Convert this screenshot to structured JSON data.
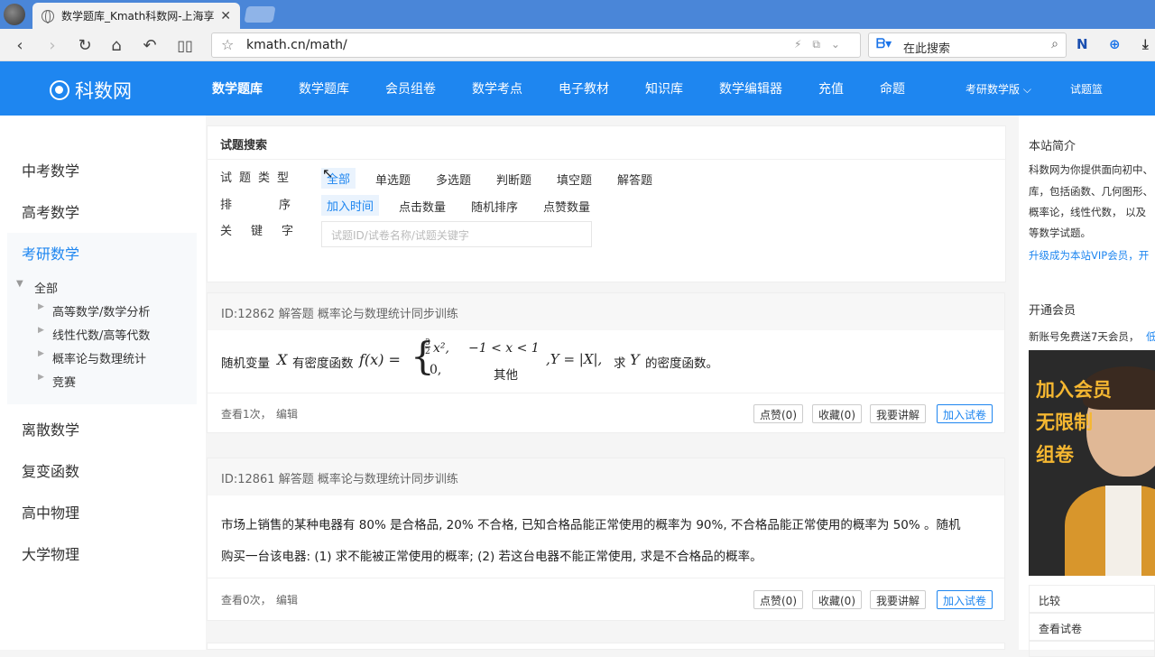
{
  "browser": {
    "tab_title": "数学题库_Kmath科数网-上海享",
    "url": "kmath.cn/math/",
    "search_placeholder": "在此搜索"
  },
  "site": {
    "logo_text": "科数网",
    "nav": [
      "数学题库",
      "数学题库",
      "会员组卷",
      "数学考点",
      "电子教材",
      "知识库",
      "数学编辑器",
      "充值",
      "命题",
      "考研数学版",
      "试题篮"
    ]
  },
  "sidebar": {
    "items": [
      "中考数学",
      "高考数学",
      "考研数学",
      "离散数学",
      "复变函数",
      "高中物理",
      "大学物理"
    ],
    "tree_root": "全部",
    "tree_children": [
      "高等数学/数学分析",
      "线性代数/高等代数",
      "概率论与数理统计",
      "竞赛"
    ]
  },
  "filter": {
    "title": "试题搜索",
    "type_label": "试题类型",
    "type_options": [
      "全部",
      "单选题",
      "多选题",
      "判断题",
      "填空题",
      "解答题"
    ],
    "sort_label": "排序",
    "sort_options": [
      "加入时间",
      "点击数量",
      "随机排序",
      "点赞数量"
    ],
    "keyword_label": "关键字",
    "keyword_placeholder": "试题ID/试卷名称/试题关键字"
  },
  "questions": [
    {
      "header": "ID:12862 解答题 概率论与数理统计同步训练",
      "text_a": "随机变量",
      "var_x": "X",
      "text_b": "有密度函数",
      "fx": "f(x) =",
      "case1_val": "x²,",
      "case1_frac_num": "3",
      "case1_frac_den": "2",
      "case1_cond": "−1 < x < 1",
      "case2_val": "0,",
      "case2_cond": "其他",
      "y_def": ",Y = |X|,",
      "text_c": "求",
      "var_y": "Y",
      "text_d": "的密度函数。",
      "views": "查看1次，",
      "edit": "编辑",
      "like": "点赞(0)",
      "fav": "收藏(0)",
      "explain": "我要讲解",
      "add": "加入试卷"
    },
    {
      "header": "ID:12861 解答题 概率论与数理统计同步训练",
      "line1": "市场上销售的某种电器有 80% 是合格品, 20% 不合格, 已知合格品能正常使用的概率为 90%, 不合格品能正常使用的概率为 50% 。随机",
      "line2": "购买一台该电器: (1) 求不能被正常使用的概率; (2) 若这台电器不能正常使用, 求是不合格品的概率。",
      "views": "查看0次，",
      "edit": "编辑",
      "like": "点赞(0)",
      "fav": "收藏(0)",
      "explain": "我要讲解",
      "add": "加入试卷"
    }
  ],
  "right": {
    "intro_title": "本站简介",
    "intro_lines": [
      "科数网为你提供面向初中、",
      "库，包括函数、几何图形、",
      "概率论，线性代数， 以及",
      "等数学试题。"
    ],
    "vip_link": "升级成为本站VIP会员，开",
    "member_title": "开通会员",
    "member_text": "新账号免费送7天会员，",
    "member_link": "低",
    "promo_lines": [
      "加入会员",
      "无限制",
      "组卷"
    ],
    "links": [
      "比较",
      "查看试卷"
    ]
  }
}
